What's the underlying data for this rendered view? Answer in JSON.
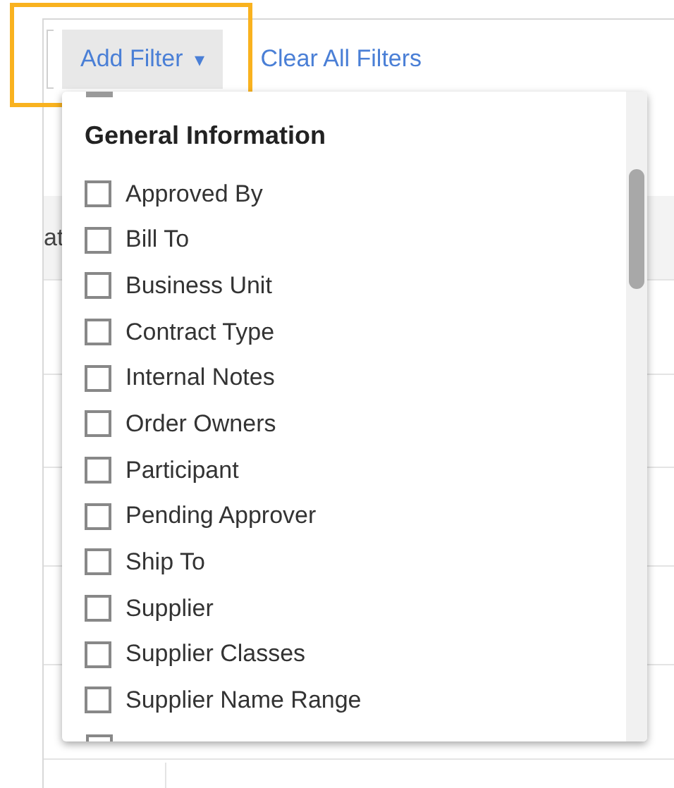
{
  "toolbar": {
    "add_filter": {
      "label": "Add Filter",
      "caret": "▾",
      "highlighted": true
    },
    "clear_all": "Clear All Filters"
  },
  "background_table": {
    "partial_text": "at"
  },
  "filter_menu": {
    "section": "General Information",
    "options": [
      {
        "label": "Approved By",
        "checked": false
      },
      {
        "label": "Bill To",
        "checked": false
      },
      {
        "label": "Business Unit",
        "checked": false
      },
      {
        "label": "Contract Type",
        "checked": false
      },
      {
        "label": "Internal Notes",
        "checked": false
      },
      {
        "label": "Order Owners",
        "checked": false
      },
      {
        "label": "Participant",
        "checked": false
      },
      {
        "label": "Pending Approver",
        "checked": false
      },
      {
        "label": "Ship To",
        "checked": false
      },
      {
        "label": "Supplier",
        "checked": false
      },
      {
        "label": "Supplier Classes",
        "checked": false
      },
      {
        "label": "Supplier Name Range",
        "checked": false
      }
    ]
  }
}
